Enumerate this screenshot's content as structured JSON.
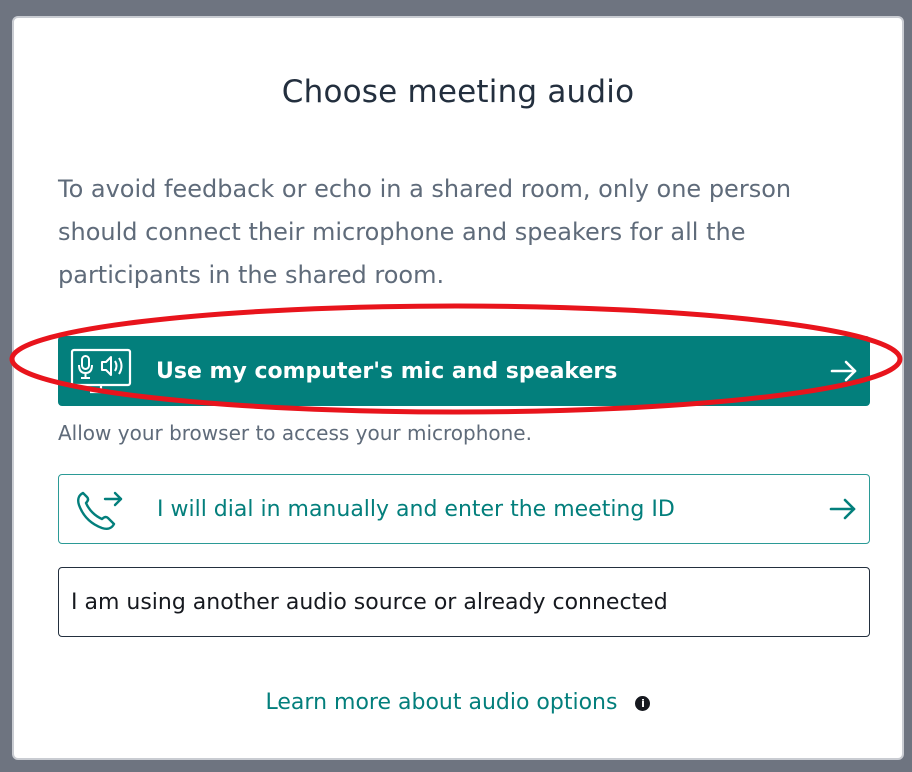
{
  "dialog": {
    "title": "Choose meeting audio",
    "description": "To avoid feedback or echo in a shared room, only one person should connect their microphone and speakers for all the participants in the shared room.",
    "options": [
      {
        "label": "Use my computer's mic and speakers",
        "icon": "computer-mic-speaker-icon",
        "arrow": "arrow-right-icon"
      },
      {
        "label": "I will dial in manually and enter the meeting ID",
        "icon": "phone-dial-out-icon",
        "arrow": "arrow-right-icon"
      },
      {
        "label": "I am using another audio source or already connected"
      }
    ],
    "hint": "Allow your browser to access your microphone.",
    "learn_more": "Learn more about audio options",
    "info_icon_glyph": "i"
  },
  "colors": {
    "accent": "#037f7c",
    "overlay": "#6e7480",
    "highlight": "#e8141c"
  }
}
